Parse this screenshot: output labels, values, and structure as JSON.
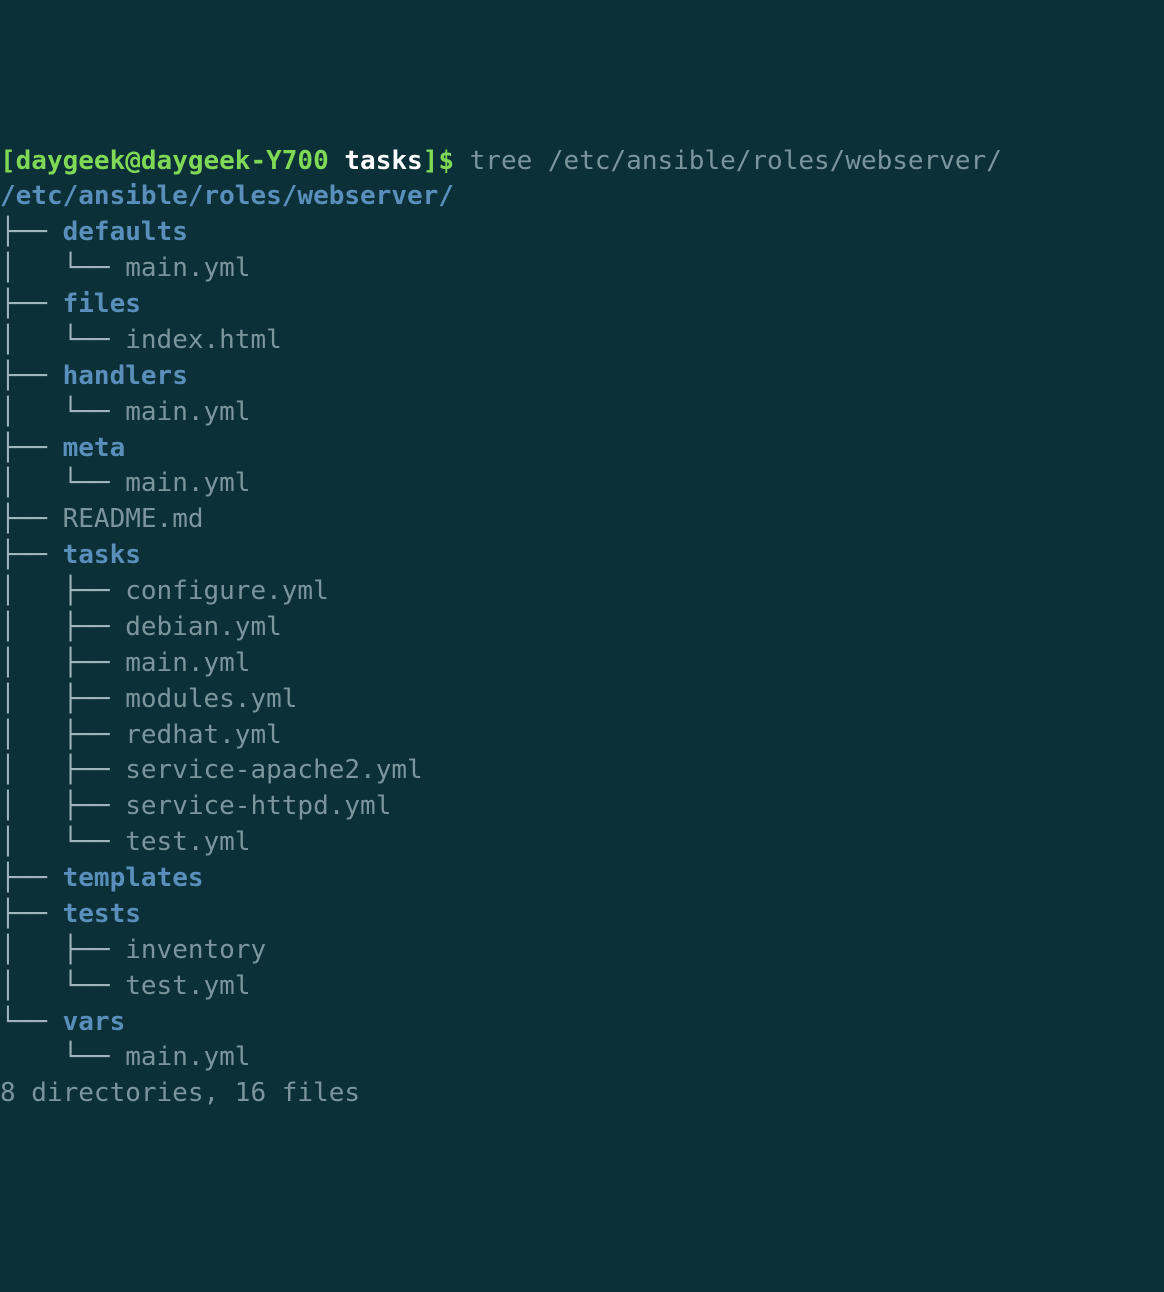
{
  "prompt": {
    "bracket_open": "[",
    "user_host": "daygeek@daygeek-Y700",
    "space": " ",
    "cwd": "tasks",
    "bracket_close": "]",
    "dollar": "$ ",
    "command": "tree /etc/ansible/roles/webserver/"
  },
  "root_path": "/etc/ansible/roles/webserver/",
  "tree_lines": [
    {
      "prefix": "├── ",
      "name": "defaults",
      "is_dir": true
    },
    {
      "prefix": "│   └── ",
      "name": "main.yml",
      "is_dir": false
    },
    {
      "prefix": "├── ",
      "name": "files",
      "is_dir": true
    },
    {
      "prefix": "│   └── ",
      "name": "index.html",
      "is_dir": false
    },
    {
      "prefix": "├── ",
      "name": "handlers",
      "is_dir": true
    },
    {
      "prefix": "│   └── ",
      "name": "main.yml",
      "is_dir": false
    },
    {
      "prefix": "├── ",
      "name": "meta",
      "is_dir": true
    },
    {
      "prefix": "│   └── ",
      "name": "main.yml",
      "is_dir": false
    },
    {
      "prefix": "├── ",
      "name": "README.md",
      "is_dir": false
    },
    {
      "prefix": "├── ",
      "name": "tasks",
      "is_dir": true
    },
    {
      "prefix": "│   ├── ",
      "name": "configure.yml",
      "is_dir": false
    },
    {
      "prefix": "│   ├── ",
      "name": "debian.yml",
      "is_dir": false
    },
    {
      "prefix": "│   ├── ",
      "name": "main.yml",
      "is_dir": false
    },
    {
      "prefix": "│   ├── ",
      "name": "modules.yml",
      "is_dir": false
    },
    {
      "prefix": "│   ├── ",
      "name": "redhat.yml",
      "is_dir": false
    },
    {
      "prefix": "│   ├── ",
      "name": "service-apache2.yml",
      "is_dir": false
    },
    {
      "prefix": "│   ├── ",
      "name": "service-httpd.yml",
      "is_dir": false
    },
    {
      "prefix": "│   └── ",
      "name": "test.yml",
      "is_dir": false
    },
    {
      "prefix": "├── ",
      "name": "templates",
      "is_dir": true
    },
    {
      "prefix": "├── ",
      "name": "tests",
      "is_dir": true
    },
    {
      "prefix": "│   ├── ",
      "name": "inventory",
      "is_dir": false
    },
    {
      "prefix": "│   └── ",
      "name": "test.yml",
      "is_dir": false
    },
    {
      "prefix": "└── ",
      "name": "vars",
      "is_dir": true
    },
    {
      "prefix": "    └── ",
      "name": "main.yml",
      "is_dir": false
    }
  ],
  "summary": "8 directories, 16 files"
}
